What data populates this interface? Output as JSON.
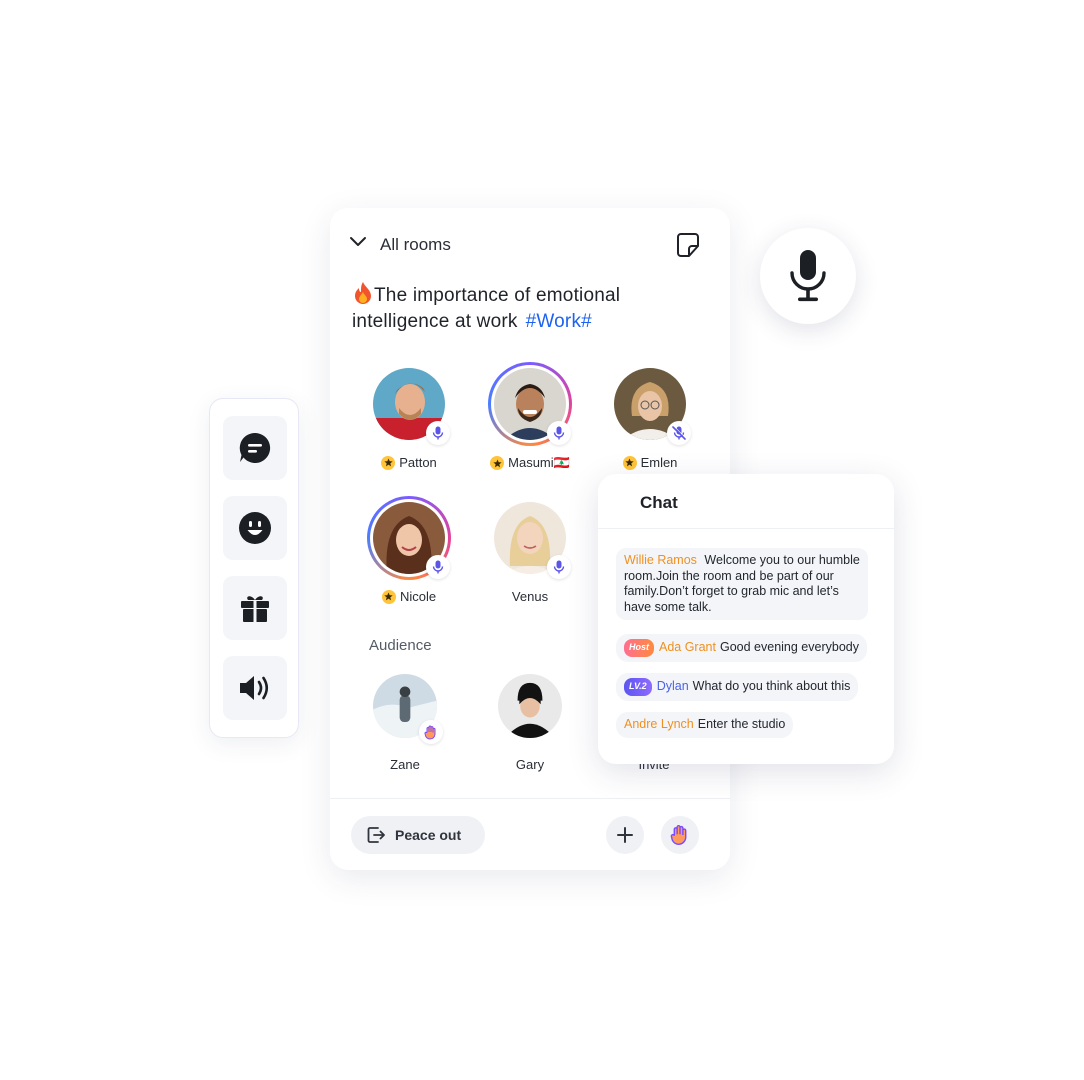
{
  "room": {
    "header": {
      "back_label": "All rooms",
      "note_icon": "sticky-note-icon"
    },
    "title": "The importance of emotional intelligence at work",
    "title_emoji": "fire-icon",
    "tag": "#Work#",
    "speakers": [
      {
        "name": "Patton",
        "host_star": true,
        "mic": "on",
        "ring": false
      },
      {
        "name": "Masumi🇱🇧",
        "host_star": true,
        "mic": "on",
        "ring": true
      },
      {
        "name": "Emlen",
        "host_star": true,
        "mic": "muted",
        "ring": false
      },
      {
        "name": "Nicole",
        "host_star": true,
        "mic": "on",
        "ring": true
      },
      {
        "name": "Venus",
        "host_star": false,
        "mic": "on",
        "ring": false
      }
    ],
    "audience_label": "Audience",
    "audience": [
      {
        "name": "Zane",
        "hand_raised": true
      },
      {
        "name": "Gary",
        "hand_raised": false
      },
      {
        "name": "Invite",
        "hand_raised": false
      }
    ],
    "footer": {
      "leave_label": "Peace out",
      "add_icon": "plus-icon",
      "raise_hand_icon": "raise-hand-icon"
    }
  },
  "side_toolbar": {
    "items": [
      "chat-bubble-icon",
      "emoji-icon",
      "gift-icon",
      "speaker-icon"
    ]
  },
  "floating_mic": "microphone-icon",
  "chat": {
    "title": "Chat",
    "messages": [
      {
        "user": "Willie Ramos",
        "badge": "",
        "text": "Welcome you to our humble room.Join the room and be part of our family.Don’t forget to grab mic and let’s have some talk."
      },
      {
        "user": "Ada Grant",
        "badge": "Host",
        "text": "Good evening everybody"
      },
      {
        "user": "Dylan",
        "badge": "LV.2",
        "text": "What do you think about this"
      },
      {
        "user": "Andre Lynch",
        "badge": "",
        "text": "Enter the studio"
      }
    ]
  },
  "colors": {
    "accent_blue": "#1e63f0",
    "username_orange": "#f0901e",
    "username_blue": "#4a63e6",
    "mic_purple": "#5a55e8",
    "star_gold": "#ffc43a"
  }
}
